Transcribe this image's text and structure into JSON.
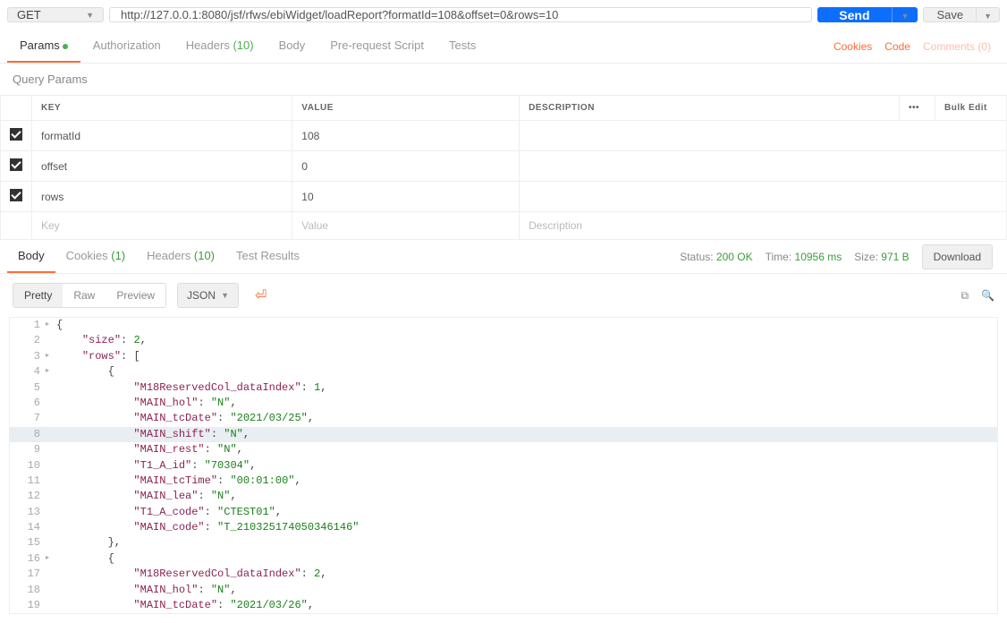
{
  "method": "GET",
  "url": "http://127.0.0.1:8080/jsf/rfws/ebiWidget/loadReport?formatId=108&offset=0&rows=10",
  "sendLabel": "Send",
  "saveLabel": "Save",
  "reqTabs": {
    "params": "Params",
    "authorization": "Authorization",
    "headers": "Headers",
    "headersCount": "(10)",
    "body": "Body",
    "prerequest": "Pre-request Script",
    "tests": "Tests"
  },
  "rightLinks": {
    "cookies": "Cookies",
    "code": "Code",
    "comments": "Comments (0)"
  },
  "sectionTitle": "Query Params",
  "tableHeaders": {
    "key": "KEY",
    "value": "VALUE",
    "description": "DESCRIPTION",
    "bulk": "Bulk Edit"
  },
  "params": [
    {
      "key": "formatId",
      "value": "108"
    },
    {
      "key": "offset",
      "value": "0"
    },
    {
      "key": "rows",
      "value": "10"
    }
  ],
  "placeholders": {
    "key": "Key",
    "value": "Value",
    "description": "Description"
  },
  "respTabs": {
    "body": "Body",
    "cookies": "Cookies",
    "cookiesCount": "(1)",
    "headers": "Headers",
    "headersCount": "(10)",
    "testResults": "Test Results"
  },
  "status": {
    "label": "Status:",
    "value": "200 OK"
  },
  "time": {
    "label": "Time:",
    "value": "10956 ms"
  },
  "size": {
    "label": "Size:",
    "value": "971 B"
  },
  "downloadLabel": "Download",
  "viewModes": {
    "pretty": "Pretty",
    "raw": "Raw",
    "preview": "Preview"
  },
  "format": "JSON",
  "response": {
    "line1": "{",
    "line2_k": "\"size\"",
    "line2_v": "2",
    "line3_k": "\"rows\"",
    "line3_v": "[",
    "line4": "{",
    "line5_k": "\"M18ReservedCol_dataIndex\"",
    "line5_v": "1",
    "line6_k": "\"MAIN_hol\"",
    "line6_v": "\"N\"",
    "line7_k": "\"MAIN_tcDate\"",
    "line7_v": "\"2021/03/25\"",
    "line8_k": "\"MAIN_shift\"",
    "line8_v": "\"N\"",
    "line9_k": "\"MAIN_rest\"",
    "line9_v": "\"N\"",
    "line10_k": "\"T1_A_id\"",
    "line10_v": "\"70304\"",
    "line11_k": "\"MAIN_tcTime\"",
    "line11_v": "\"00:01:00\"",
    "line12_k": "\"MAIN_lea\"",
    "line12_v": "\"N\"",
    "line13_k": "\"T1_A_code\"",
    "line13_v": "\"CTEST01\"",
    "line14_k": "\"MAIN_code\"",
    "line14_v": "\"T_210325174050346146\"",
    "line15": "},",
    "line16": "{",
    "line17_k": "\"M18ReservedCol_dataIndex\"",
    "line17_v": "2",
    "line18_k": "\"MAIN_hol\"",
    "line18_v": "\"N\"",
    "line19_k": "\"MAIN_tcDate\"",
    "line19_v": "\"2021/03/26\""
  }
}
